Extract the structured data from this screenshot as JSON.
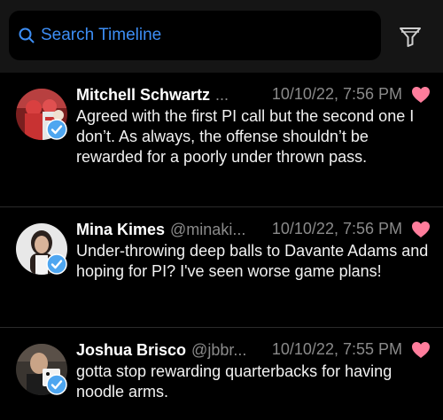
{
  "search": {
    "placeholder": "Search Timeline",
    "icon": "search-icon"
  },
  "filter": {
    "icon": "filter-icon"
  },
  "colors": {
    "accent": "#3d8ef5",
    "heart": "#ff7d9c",
    "verified": "#4ea6f0"
  },
  "tweets": [
    {
      "name": "Mitchell Schwartz",
      "handle": "...",
      "time": "10/10/22, 7:56 PM",
      "text": "Agreed with the first PI call but the second one I don’t. As always, the offense shouldn’t be rewarded for a poorly under thrown pass."
    },
    {
      "name": "Mina Kimes",
      "handle": "@minaki...",
      "time": "10/10/22, 7:56 PM",
      "text": "Under-throwing deep balls to Davante Adams and hoping for PI? I've seen worse game plans!"
    },
    {
      "name": "Joshua Brisco",
      "handle": "@jbbr...",
      "time": "10/10/22, 7:55 PM",
      "text": "gotta stop rewarding quarterbacks for having noodle arms."
    }
  ]
}
